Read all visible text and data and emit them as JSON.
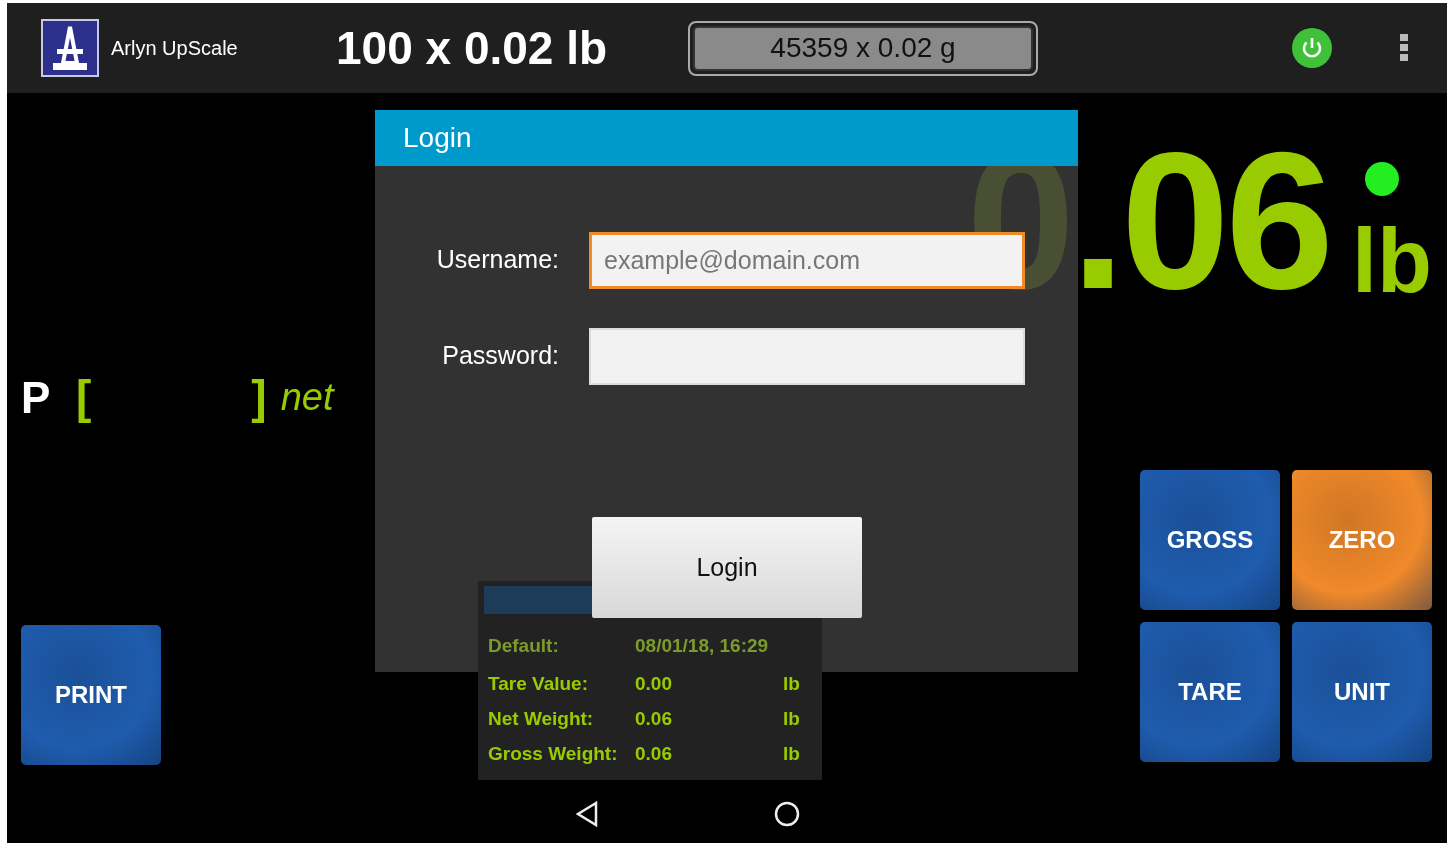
{
  "app": {
    "name": "Arlyn UpScale",
    "capacity": "100 x 0.02 lb",
    "resolution": "45359 x 0.02 g"
  },
  "indicator": {
    "on": true
  },
  "weight": {
    "value": "0.06",
    "unit": "lb"
  },
  "preset": {
    "prefix": "P",
    "open": "[",
    "close": "]",
    "mode": "net"
  },
  "print_button": {
    "label": "PRINT",
    "color": "#1f5cae"
  },
  "keypad": [
    {
      "label": "GROSS",
      "color": "#1f5cae"
    },
    {
      "label": "ZERO",
      "color": "#f0892a"
    },
    {
      "label": "TARE",
      "color": "#1f5cae"
    },
    {
      "label": "UNIT",
      "color": "#1f5cae"
    }
  ],
  "info_panel": {
    "rows": [
      {
        "label": "Default:",
        "value": "08/01/18, 16:29"
      },
      {
        "label": "Tare Value:",
        "value": "0.00",
        "unit": "lb"
      },
      {
        "label": "Net Weight:",
        "value": "0.06",
        "unit": "lb"
      },
      {
        "label": "Gross Weight:",
        "value": "0.06",
        "unit": "lb"
      }
    ]
  },
  "dialog": {
    "title": "Login",
    "fields": [
      {
        "label": "Username:",
        "placeholder": "example@domain.com",
        "focused": true
      },
      {
        "label": "Password:",
        "focused": false
      }
    ],
    "submit": "Login"
  }
}
